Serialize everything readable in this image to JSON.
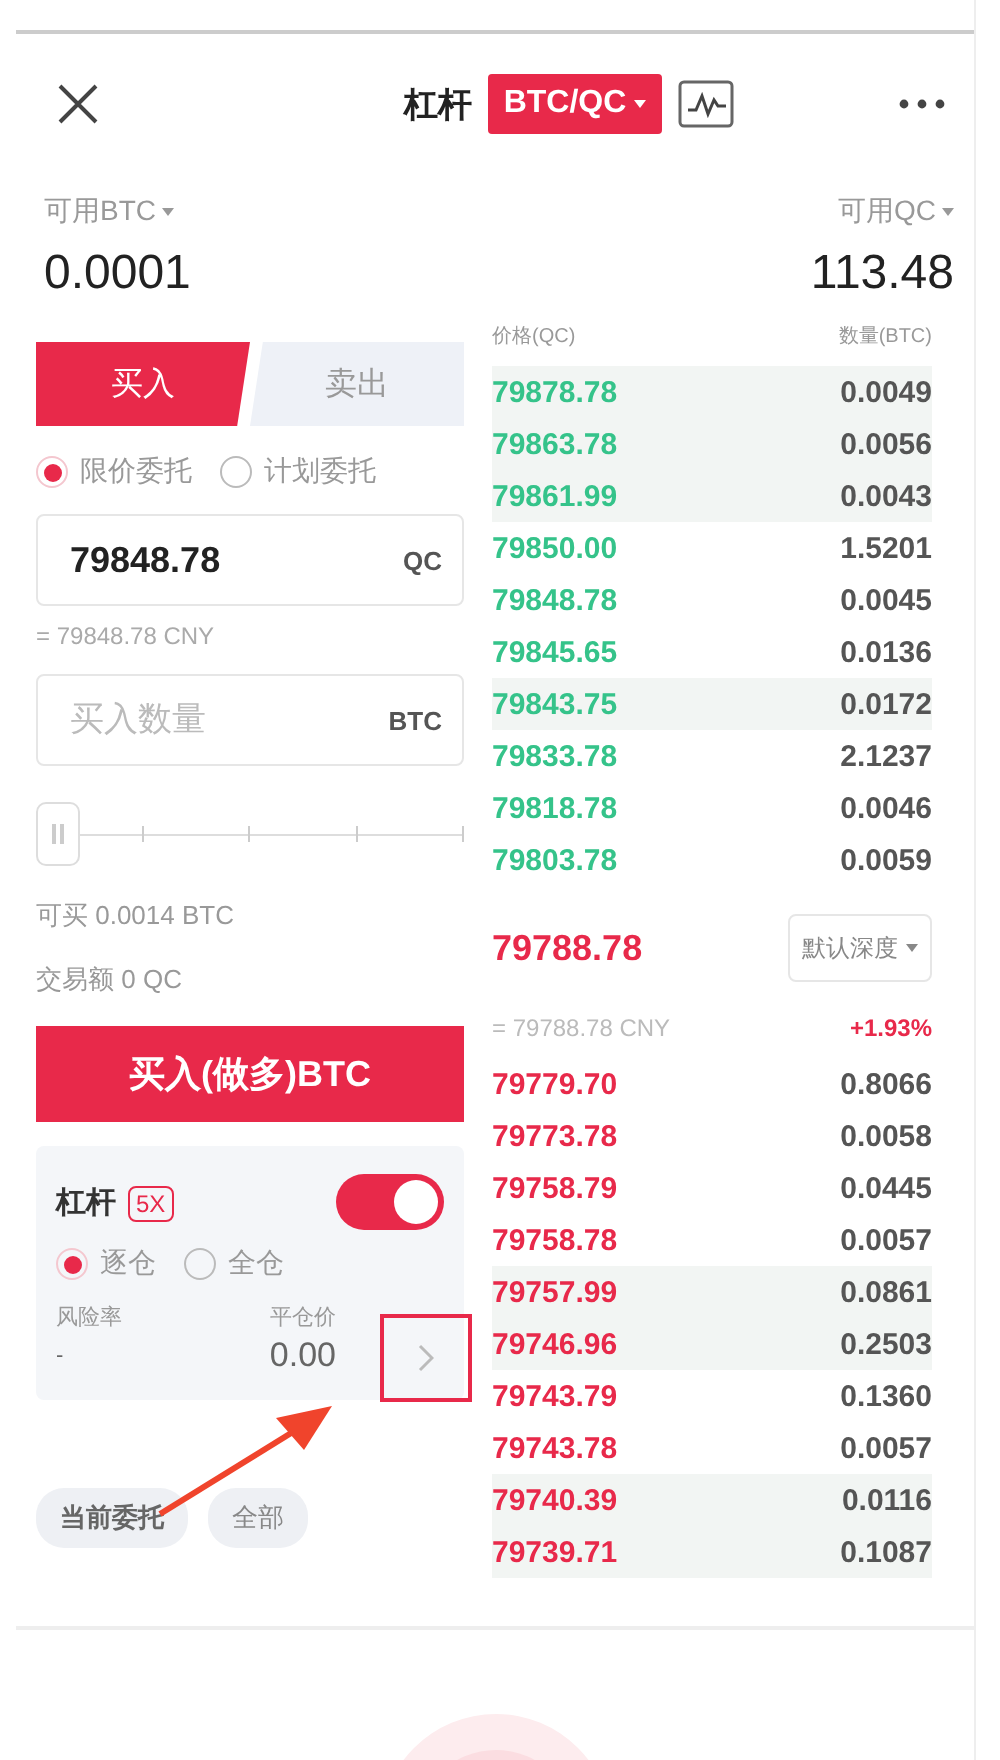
{
  "header": {
    "title": "杠杆",
    "pair": "BTC/QC"
  },
  "balances": [
    {
      "label": "可用BTC",
      "value": "0.0001"
    },
    {
      "label": "可用QC",
      "value": "113.48"
    }
  ],
  "side_tabs": [
    {
      "label": "买入",
      "selected": true
    },
    {
      "label": "卖出",
      "selected": false
    }
  ],
  "order_types": [
    {
      "label": "限价委托",
      "selected": true
    },
    {
      "label": "计划委托",
      "selected": false
    }
  ],
  "price_field": {
    "value": "79848.78",
    "unit": "QC",
    "converted": "= 79848.78 CNY"
  },
  "amount_field": {
    "placeholder": "买入数量",
    "unit": "BTC"
  },
  "amount_slider": {
    "level": 0
  },
  "can_buy": "可买 0.0014 BTC",
  "turnover": "交易额 0 QC",
  "submit_button": "买入(做多)BTC",
  "leverage": {
    "label": "杠杆",
    "multiplier": "5X",
    "on": true,
    "margin_modes": [
      {
        "label": "逐仓",
        "selected": true
      },
      {
        "label": "全仓",
        "selected": false
      }
    ],
    "risk_label": "风险率",
    "risk_value": "-",
    "liq_label": "平仓价",
    "liq_value": "0.00"
  },
  "order_filters": [
    {
      "label": "当前委托",
      "selected": true
    },
    {
      "label": "全部",
      "selected": false
    }
  ],
  "order_book": {
    "price_header": "价格(QC)",
    "amount_header": "数量(BTC)",
    "asks": [
      {
        "price": "79878.78",
        "amount": "0.0049",
        "highlighted": true
      },
      {
        "price": "79863.78",
        "amount": "0.0056",
        "highlighted": true
      },
      {
        "price": "79861.99",
        "amount": "0.0043",
        "highlighted": true
      },
      {
        "price": "79850.00",
        "amount": "1.5201",
        "highlighted": false
      },
      {
        "price": "79848.78",
        "amount": "0.0045",
        "highlighted": false
      },
      {
        "price": "79845.65",
        "amount": "0.0136",
        "highlighted": false
      },
      {
        "price": "79843.75",
        "amount": "0.0172",
        "highlighted": true
      },
      {
        "price": "79833.78",
        "amount": "2.1237",
        "highlighted": false
      },
      {
        "price": "79818.78",
        "amount": "0.0046",
        "highlighted": false
      },
      {
        "price": "79803.78",
        "amount": "0.0059",
        "highlighted": false
      }
    ],
    "last_price": "79788.78",
    "depth_select": "默认深度",
    "last_cny": "= 79788.78 CNY",
    "change": "+1.93%",
    "bids": [
      {
        "price": "79779.70",
        "amount": "0.8066",
        "highlighted": false
      },
      {
        "price": "79773.78",
        "amount": "0.0058",
        "highlighted": false
      },
      {
        "price": "79758.79",
        "amount": "0.0445",
        "highlighted": false
      },
      {
        "price": "79758.78",
        "amount": "0.0057",
        "highlighted": false
      },
      {
        "price": "79757.99",
        "amount": "0.0861",
        "highlighted": true
      },
      {
        "price": "79746.96",
        "amount": "0.2503",
        "highlighted": true
      },
      {
        "price": "79743.79",
        "amount": "0.1360",
        "highlighted": false
      },
      {
        "price": "79743.78",
        "amount": "0.0057",
        "highlighted": false
      },
      {
        "price": "79740.39",
        "amount": "0.0116",
        "highlighted": true
      },
      {
        "price": "79739.71",
        "amount": "0.1087",
        "highlighted": true
      }
    ]
  }
}
